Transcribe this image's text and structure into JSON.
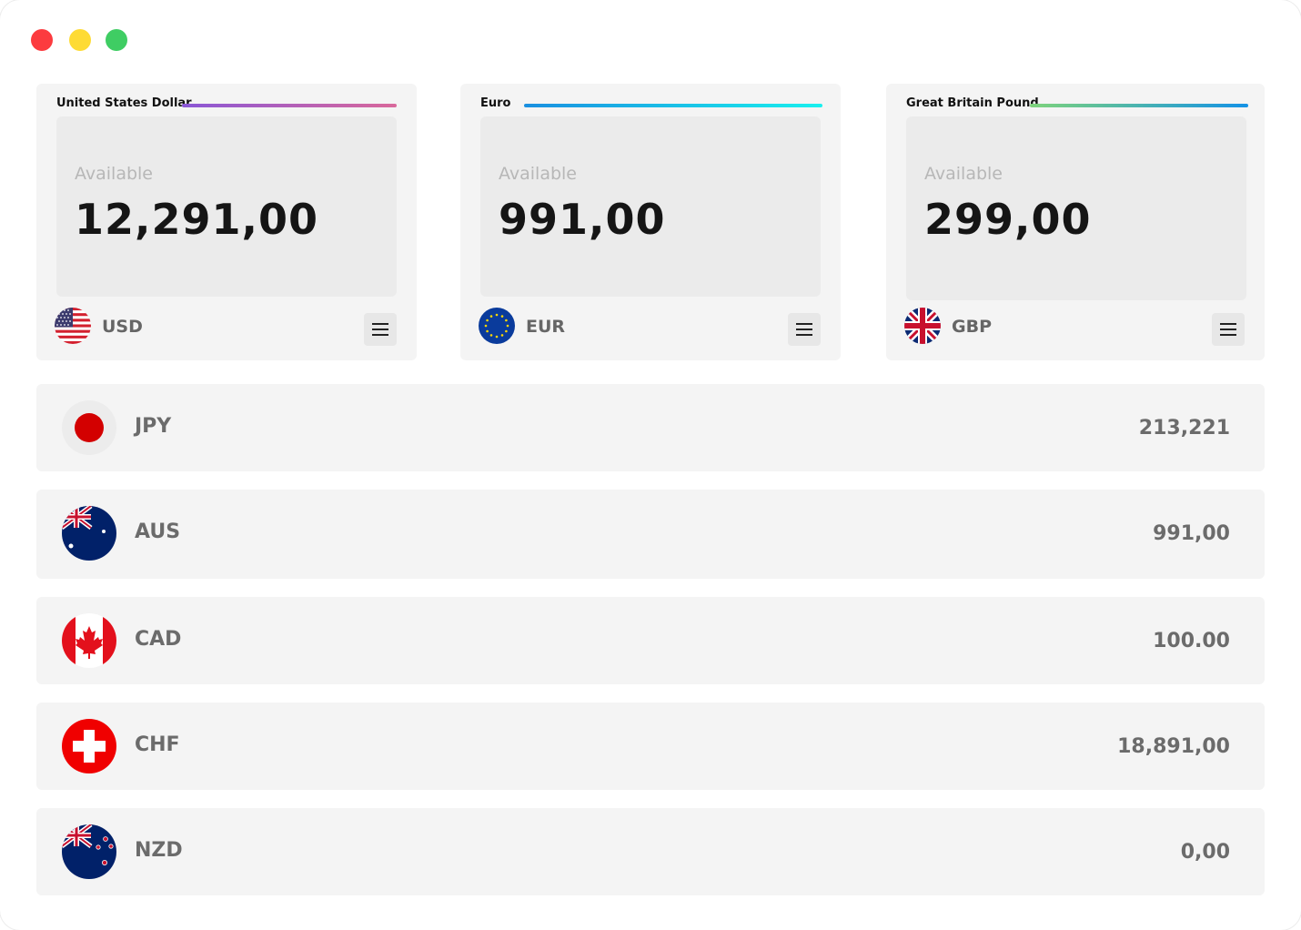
{
  "window_controls": [
    "close",
    "minimize",
    "maximize"
  ],
  "cards": [
    {
      "title": "United States Dollar",
      "available_label": "Available",
      "amount": "12,291,00",
      "code": "USD",
      "flag_icon": "us-flag-icon",
      "line_colors": [
        "#8a57d6",
        "#d9689b"
      ]
    },
    {
      "title": "Euro",
      "available_label": "Available",
      "amount": "991,00",
      "code": "EUR",
      "flag_icon": "eu-flag-icon",
      "line_colors": [
        "#1a8fe0",
        "#19f0ee"
      ]
    },
    {
      "title": "Great Britain Pound",
      "available_label": "Available",
      "amount": "299,00",
      "code": "GBP",
      "flag_icon": "uk-flag-icon",
      "line_colors": [
        "#7ed37b",
        "#1492e6"
      ]
    }
  ],
  "rows": [
    {
      "code": "JPY",
      "value": "213,221",
      "flag_icon": "japan-flag-icon"
    },
    {
      "code": "AUS",
      "value": "991,00",
      "flag_icon": "australia-flag-icon"
    },
    {
      "code": "CAD",
      "value": "100.00",
      "flag_icon": "canada-flag-icon"
    },
    {
      "code": "CHF",
      "value": "18,891,00",
      "flag_icon": "switzerland-flag-icon"
    },
    {
      "code": "NZD",
      "value": "0,00",
      "flag_icon": "new-zealand-flag-icon"
    }
  ]
}
